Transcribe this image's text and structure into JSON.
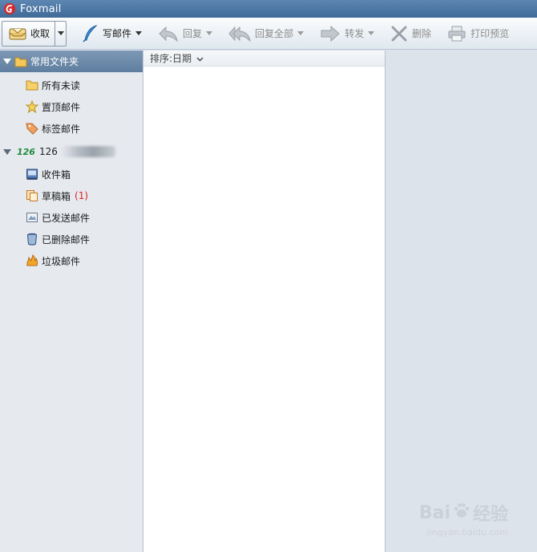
{
  "window": {
    "title": "Foxmail"
  },
  "toolbar": {
    "receive": "收取",
    "compose": "写邮件",
    "reply": "回复",
    "reply_all": "回复全部",
    "forward": "转发",
    "delete": "删除",
    "print_preview": "打印预览"
  },
  "sidebar": {
    "favorites_header": "常用文件夹",
    "favorites": [
      {
        "label": "所有未读",
        "icon": "folder-icon"
      },
      {
        "label": "置顶邮件",
        "icon": "star-icon"
      },
      {
        "label": "标签邮件",
        "icon": "tag-icon"
      }
    ],
    "account": {
      "badge": "126",
      "name": "126"
    },
    "folders": [
      {
        "label": "收件箱",
        "icon": "inbox-icon",
        "count": ""
      },
      {
        "label": "草稿箱",
        "icon": "drafts-icon",
        "count": "(1)"
      },
      {
        "label": "已发送邮件",
        "icon": "sent-icon",
        "count": ""
      },
      {
        "label": "已删除邮件",
        "icon": "trash-icon",
        "count": ""
      },
      {
        "label": "垃圾邮件",
        "icon": "junk-icon",
        "count": ""
      }
    ]
  },
  "list": {
    "sort_label": "排序:日期"
  },
  "watermark": {
    "brand": "Bai",
    "brand_suffix": "经验",
    "url": "jingyan.baidu.com"
  },
  "colors": {
    "titlebar": "#4a76a4",
    "sidebar_header": "#6d8aab",
    "count_red": "#e02020"
  }
}
